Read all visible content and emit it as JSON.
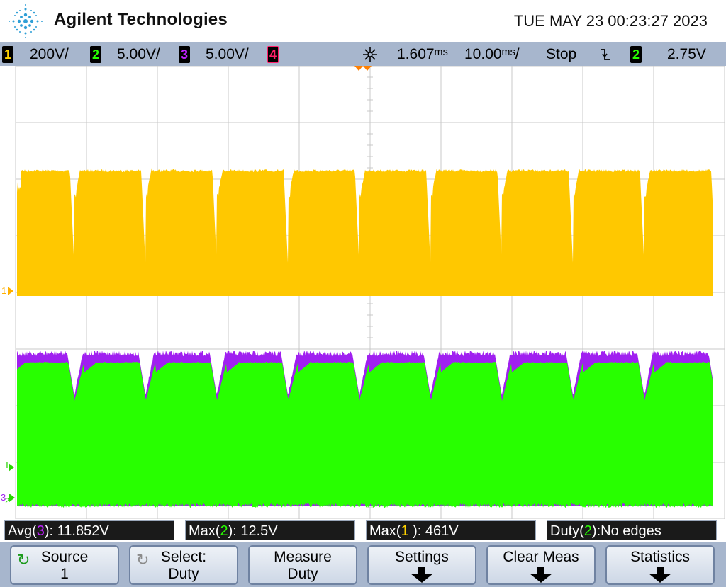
{
  "header": {
    "brand": "Agilent Technologies",
    "datetime": "TUE MAY 23 00:23:27 2023"
  },
  "statusbar": {
    "ch1": {
      "num": "1",
      "scale": "200V/"
    },
    "ch2": {
      "num": "2",
      "scale": "5.00V/"
    },
    "ch3": {
      "num": "3",
      "scale": "5.00V/"
    },
    "ch4": {
      "num": "4"
    },
    "delay": "1.607ᵐˢ",
    "timebase": "10.00ᵐˢ/",
    "run_state": "Stop",
    "trigger_slope_icon": "falling-edge-icon",
    "trigger_source": "2",
    "trigger_level": "2.75V"
  },
  "screen_markers": {
    "ch1_marker": "1",
    "trigger_marker": "T",
    "ch3_marker": "3",
    "ch2_marker": "2"
  },
  "colors": {
    "ch1": "#ffc800",
    "ch2": "#28ff00",
    "ch3": "#a020f0",
    "ch4": "#ff1f6a",
    "grid": "#c9c9c9",
    "statusbar": "#a7b6cd"
  },
  "measurements": [
    {
      "pre": "Avg(",
      "ch": "3",
      "post": "): 11.852V"
    },
    {
      "pre": "Max(",
      "ch": "2",
      "post": "): 12.5V"
    },
    {
      "pre": "Max(",
      "ch": "1",
      "post": " ): 461V"
    },
    {
      "pre": "Duty(",
      "ch": "2",
      "post": "):No edges"
    }
  ],
  "softkeys": [
    {
      "line1": "Source",
      "line2": "1",
      "icon": "rotary-knob-icon"
    },
    {
      "line1": "Select:",
      "line2": "Duty",
      "icon": "rotary-knob-icon"
    },
    {
      "line1": "Measure",
      "line2": "Duty"
    },
    {
      "line1": "Settings",
      "icon": "down-arrow-icon"
    },
    {
      "line1": "Clear Meas",
      "icon": "down-arrow-icon"
    },
    {
      "line1": "Statistics",
      "icon": "down-arrow-icon"
    }
  ]
}
